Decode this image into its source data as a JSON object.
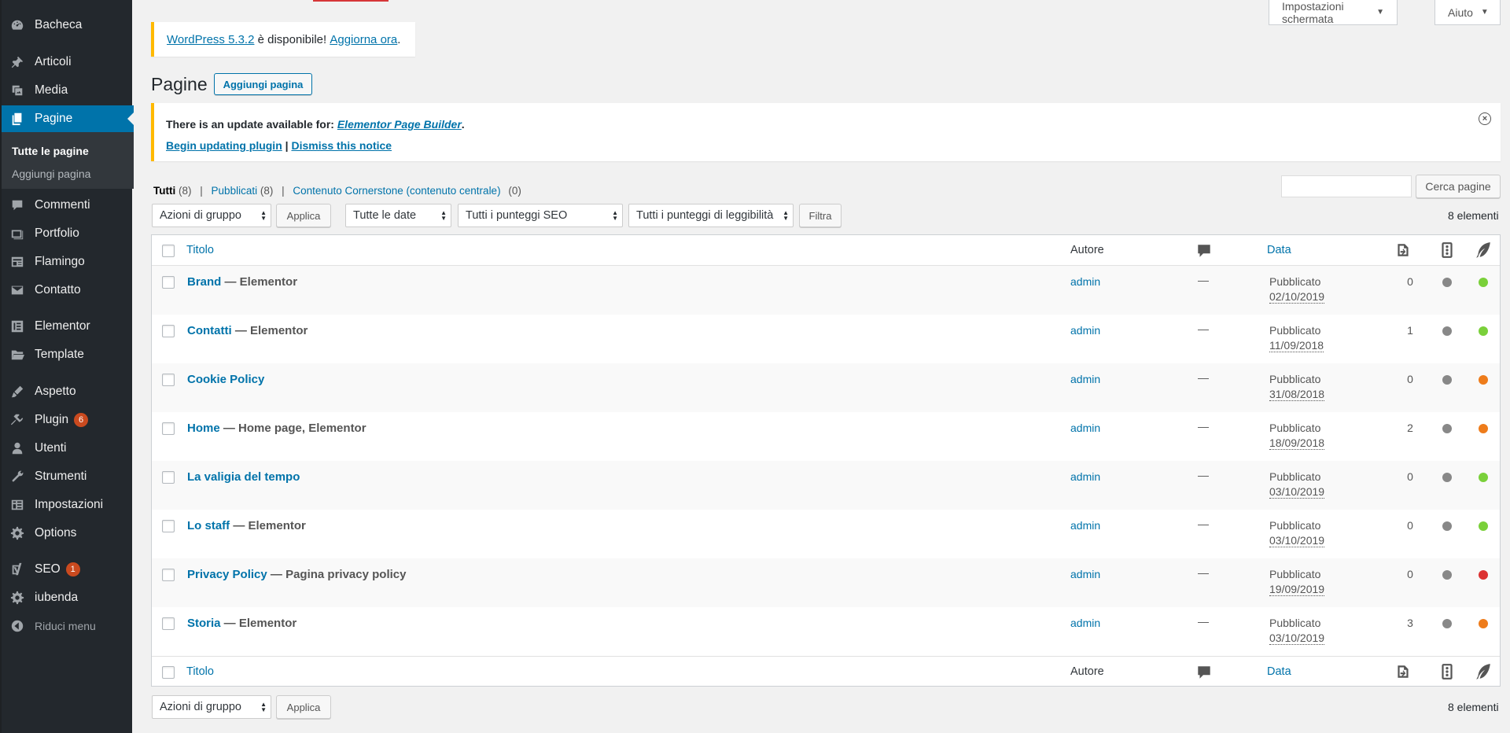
{
  "colors": {
    "seo_gray": "#888888",
    "green": "#7ad03a",
    "orange": "#ee7c1b",
    "red": "#dc3232"
  },
  "sidebar": {
    "items": [
      {
        "label": "Bacheca",
        "icon": "dashboard-icon"
      },
      {
        "label": "Articoli",
        "icon": "pin-icon"
      },
      {
        "label": "Media",
        "icon": "media-icon"
      },
      {
        "label": "Pagine",
        "icon": "pages-icon"
      },
      {
        "label": "Commenti",
        "icon": "comment-icon"
      },
      {
        "label": "Portfolio",
        "icon": "portfolio-icon"
      },
      {
        "label": "Flamingo",
        "icon": "flamingo-icon"
      },
      {
        "label": "Contatto",
        "icon": "mail-icon"
      },
      {
        "label": "Elementor",
        "icon": "elementor-icon"
      },
      {
        "label": "Template",
        "icon": "folder-icon"
      },
      {
        "label": "Aspetto",
        "icon": "brush-icon"
      },
      {
        "label": "Plugin",
        "icon": "plugin-icon",
        "badge": "6"
      },
      {
        "label": "Utenti",
        "icon": "user-icon"
      },
      {
        "label": "Strumenti",
        "icon": "wrench-icon"
      },
      {
        "label": "Impostazioni",
        "icon": "settings-icon"
      },
      {
        "label": "Options",
        "icon": "gear-icon"
      },
      {
        "label": "SEO",
        "icon": "yoast-icon",
        "badge": "1"
      },
      {
        "label": "iubenda",
        "icon": "gear-icon"
      },
      {
        "label": "Riduci menu",
        "icon": "collapse-icon"
      }
    ],
    "submenu": [
      "Tutte le pagine",
      "Aggiungi pagina"
    ]
  },
  "topbar": {
    "screen_options": "Impostazioni schermata",
    "help": "Aiuto"
  },
  "wp_notice": {
    "version_link": "WordPress 5.3.2",
    "text": " è disponibile! ",
    "update_link": "Aggiorna ora",
    "end": "."
  },
  "header": {
    "title": "Pagine",
    "add_button": "Aggiungi pagina"
  },
  "plugin_notice": {
    "prefix": "There is an update available for: ",
    "plugin": "Elementor Page Builder",
    "suffix": ".",
    "begin": "Begin updating plugin",
    "sep": " | ",
    "dismiss": "Dismiss this notice"
  },
  "views": {
    "all": "Tutti",
    "all_count": "(8)",
    "published": "Pubblicati",
    "published_count": "(8)",
    "cornerstone": "Contenuto Cornerstone (contenuto centrale)",
    "cornerstone_count": "(0)",
    "sep": "|"
  },
  "search": {
    "button": "Cerca pagine"
  },
  "filters": {
    "bulk": "Azioni di gruppo",
    "apply": "Applica",
    "dates": "Tutte le date",
    "seo": "Tutti i punteggi SEO",
    "readability": "Tutti i punteggi di leggibilità",
    "filter": "Filtra",
    "count": "8 elementi"
  },
  "table": {
    "col_title": "Titolo",
    "col_author": "Autore",
    "col_date": "Data",
    "rows": [
      {
        "title": "Brand",
        "state": " — Elementor",
        "author": "admin",
        "comments": "—",
        "status": "Pubblicato",
        "date": "02/10/2019",
        "links": "0",
        "read": "green"
      },
      {
        "title": "Contatti",
        "state": " — Elementor",
        "author": "admin",
        "comments": "—",
        "status": "Pubblicato",
        "date": "11/09/2018",
        "links": "1",
        "read": "green"
      },
      {
        "title": "Cookie Policy",
        "state": "",
        "author": "admin",
        "comments": "—",
        "status": "Pubblicato",
        "date": "31/08/2018",
        "links": "0",
        "read": "orange"
      },
      {
        "title": "Home",
        "state": " — Home page, Elementor",
        "author": "admin",
        "comments": "—",
        "status": "Pubblicato",
        "date": "18/09/2018",
        "links": "2",
        "read": "orange"
      },
      {
        "title": "La valigia del tempo",
        "state": "",
        "author": "admin",
        "comments": "—",
        "status": "Pubblicato",
        "date": "03/10/2019",
        "links": "0",
        "read": "green"
      },
      {
        "title": "Lo staff",
        "state": " — Elementor",
        "author": "admin",
        "comments": "—",
        "status": "Pubblicato",
        "date": "03/10/2019",
        "links": "0",
        "read": "green"
      },
      {
        "title": "Privacy Policy",
        "state": " — Pagina privacy policy",
        "author": "admin",
        "comments": "—",
        "status": "Pubblicato",
        "date": "19/09/2019",
        "links": "0",
        "read": "red"
      },
      {
        "title": "Storia",
        "state": " — Elementor",
        "author": "admin",
        "comments": "—",
        "status": "Pubblicato",
        "date": "03/10/2019",
        "links": "3",
        "read": "orange"
      }
    ]
  }
}
